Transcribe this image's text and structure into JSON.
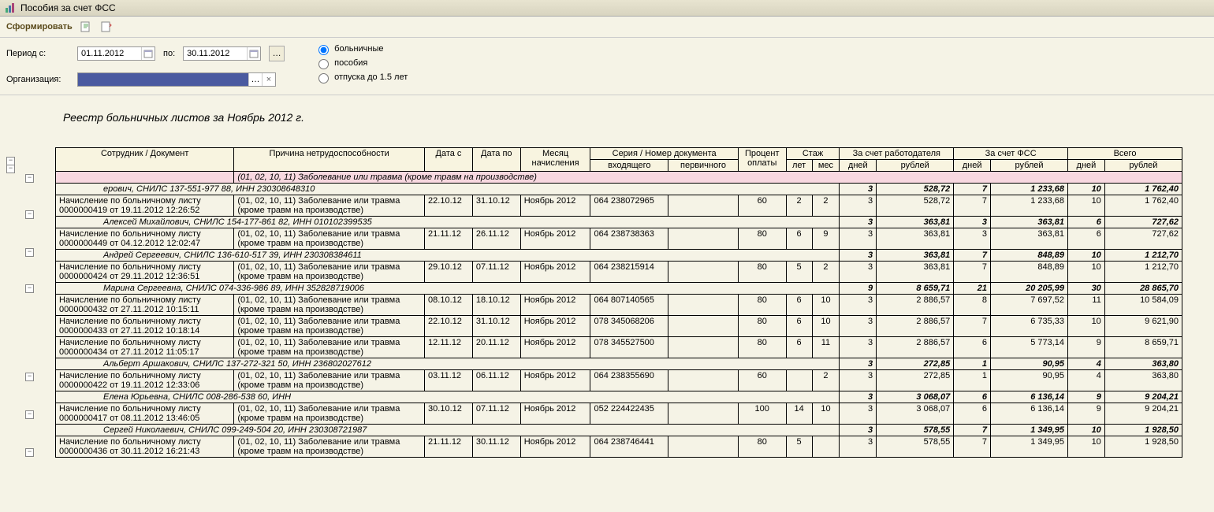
{
  "window_title": "Пособия за счет ФСС",
  "toolbar": {
    "form_label": "Сформировать"
  },
  "params": {
    "period_label": "Период с:",
    "period_to_label": "по:",
    "date_from": "01.11.2012",
    "date_to": "30.11.2012",
    "org_label": "Организация:",
    "radio_sick": "больничные",
    "radio_benefits": "пособия",
    "radio_leave": "отпуска до 1.5 лет"
  },
  "report_title": "Реестр больничных листов за Ноябрь 2012 г.",
  "headers": {
    "employee_doc": "Сотрудник / Документ",
    "reason": "Причина нетрудоспособности",
    "date_from": "Дата с",
    "date_to": "Дата по",
    "month": "Месяц начисления",
    "series_number": "Серия / Номер  документа",
    "series_in": "входящего",
    "series_primary": "первичного",
    "percent": "Процент оплаты",
    "stazh": "Стаж",
    "stazh_years": "лет",
    "stazh_months": "мес",
    "employer": "За счет работодателя",
    "fss": "За счет ФСС",
    "total": "Всего",
    "days": "дней",
    "rub": "рублей"
  },
  "pink_reason": "(01, 02, 10, 11) Заболевание или травма (кроме травм на производстве)",
  "groups": [
    {
      "header_text": "ерович, СНИЛС 137-551-977 88, ИНН 230308648310",
      "emp_days": "3",
      "emp_rub": "528,72",
      "fss_days": "7",
      "fss_rub": "1 233,68",
      "tot_days": "10",
      "tot_rub": "1 762,40",
      "rows": [
        {
          "doc": "Начисление по больничному листу 0000000419 от 19.11.2012 12:26:52",
          "reason": "(01, 02, 10, 11) Заболевание или травма (кроме травм на производстве)",
          "d1": "22.10.12",
          "d2": "31.10.12",
          "month": "Ноябрь 2012",
          "ser_in": "064 238072965",
          "ser_pr": "",
          "pct": "60",
          "yrs": "2",
          "mon": "2",
          "ed": "3",
          "er": "528,72",
          "fd": "7",
          "fr": "1 233,68",
          "td": "10",
          "tr": "1 762,40"
        }
      ]
    },
    {
      "header_text": "Алексей Михайлович, СНИЛС 154-177-861 82, ИНН 010102399535",
      "emp_days": "3",
      "emp_rub": "363,81",
      "fss_days": "3",
      "fss_rub": "363,81",
      "tot_days": "6",
      "tot_rub": "727,62",
      "rows": [
        {
          "doc": "Начисление по больничному листу 0000000449 от 04.12.2012 12:02:47",
          "reason": "(01, 02, 10, 11) Заболевание или травма (кроме травм на производстве)",
          "d1": "21.11.12",
          "d2": "26.11.12",
          "month": "Ноябрь 2012",
          "ser_in": "064 238738363",
          "ser_pr": "",
          "pct": "80",
          "yrs": "6",
          "mon": "9",
          "ed": "3",
          "er": "363,81",
          "fd": "3",
          "fr": "363,81",
          "td": "6",
          "tr": "727,62"
        }
      ]
    },
    {
      "header_text": "Андрей Сергеевич, СНИЛС 136-610-517 39, ИНН 230308384611",
      "emp_days": "3",
      "emp_rub": "363,81",
      "fss_days": "7",
      "fss_rub": "848,89",
      "tot_days": "10",
      "tot_rub": "1 212,70",
      "rows": [
        {
          "doc": "Начисление по больничному листу 0000000424 от 29.11.2012 12:36:51",
          "reason": "(01, 02, 10, 11) Заболевание или травма (кроме травм на производстве)",
          "d1": "29.10.12",
          "d2": "07.11.12",
          "month": "Ноябрь 2012",
          "ser_in": "064 238215914",
          "ser_pr": "",
          "pct": "80",
          "yrs": "5",
          "mon": "2",
          "ed": "3",
          "er": "363,81",
          "fd": "7",
          "fr": "848,89",
          "td": "10",
          "tr": "1 212,70"
        }
      ]
    },
    {
      "header_text": "Марина Сергеевна, СНИЛС 074-336-986 89, ИНН 352828719006",
      "emp_days": "9",
      "emp_rub": "8 659,71",
      "fss_days": "21",
      "fss_rub": "20 205,99",
      "tot_days": "30",
      "tot_rub": "28 865,70",
      "rows": [
        {
          "doc": "Начисление по больничному листу 0000000432 от 27.11.2012 10:15:11",
          "reason": "(01, 02, 10, 11) Заболевание или травма (кроме травм на производстве)",
          "d1": "08.10.12",
          "d2": "18.10.12",
          "month": "Ноябрь 2012",
          "ser_in": "064 807140565",
          "ser_pr": "",
          "pct": "80",
          "yrs": "6",
          "mon": "10",
          "ed": "3",
          "er": "2 886,57",
          "fd": "8",
          "fr": "7 697,52",
          "td": "11",
          "tr": "10 584,09"
        },
        {
          "doc": "Начисление по больничному листу 0000000433 от 27.11.2012 10:18:14",
          "reason": "(01, 02, 10, 11) Заболевание или травма (кроме травм на производстве)",
          "d1": "22.10.12",
          "d2": "31.10.12",
          "month": "Ноябрь 2012",
          "ser_in": "078 345068206",
          "ser_pr": "",
          "pct": "80",
          "yrs": "6",
          "mon": "10",
          "ed": "3",
          "er": "2 886,57",
          "fd": "7",
          "fr": "6 735,33",
          "td": "10",
          "tr": "9 621,90"
        },
        {
          "doc": "Начисление по больничному листу 0000000434 от 27.11.2012 11:05:17",
          "reason": "(01, 02, 10, 11) Заболевание или травма (кроме травм на производстве)",
          "d1": "12.11.12",
          "d2": "20.11.12",
          "month": "Ноябрь 2012",
          "ser_in": "078 345527500",
          "ser_pr": "",
          "pct": "80",
          "yrs": "6",
          "mon": "11",
          "ed": "3",
          "er": "2 886,57",
          "fd": "6",
          "fr": "5 773,14",
          "td": "9",
          "tr": "8 659,71"
        }
      ]
    },
    {
      "header_text": "Альберт Аршакович, СНИЛС 137-272-321 50, ИНН 236802027612",
      "emp_days": "3",
      "emp_rub": "272,85",
      "fss_days": "1",
      "fss_rub": "90,95",
      "tot_days": "4",
      "tot_rub": "363,80",
      "rows": [
        {
          "doc": "Начисление по больничному листу 0000000422 от 19.11.2012 12:33:06",
          "reason": "(01, 02, 10, 11) Заболевание или травма (кроме травм на производстве)",
          "d1": "03.11.12",
          "d2": "06.11.12",
          "month": "Ноябрь 2012",
          "ser_in": "064 238355690",
          "ser_pr": "",
          "pct": "60",
          "yrs": "",
          "mon": "2",
          "ed": "3",
          "er": "272,85",
          "fd": "1",
          "fr": "90,95",
          "td": "4",
          "tr": "363,80"
        }
      ]
    },
    {
      "header_text": "Елена Юрьевна, СНИЛС 008-286-538 60, ИНН",
      "emp_days": "3",
      "emp_rub": "3 068,07",
      "fss_days": "6",
      "fss_rub": "6 136,14",
      "tot_days": "9",
      "tot_rub": "9 204,21",
      "rows": [
        {
          "doc": "Начисление по больничному листу 0000000417 от 08.11.2012 13:46:05",
          "reason": "(01, 02, 10, 11) Заболевание или травма (кроме травм на производстве)",
          "d1": "30.10.12",
          "d2": "07.11.12",
          "month": "Ноябрь 2012",
          "ser_in": "052 224422435",
          "ser_pr": "",
          "pct": "100",
          "yrs": "14",
          "mon": "10",
          "ed": "3",
          "er": "3 068,07",
          "fd": "6",
          "fr": "6 136,14",
          "td": "9",
          "tr": "9 204,21"
        }
      ]
    },
    {
      "header_text": "Сергей Николаевич, СНИЛС 099-249-504 20, ИНН 230308721987",
      "emp_days": "3",
      "emp_rub": "578,55",
      "fss_days": "7",
      "fss_rub": "1 349,95",
      "tot_days": "10",
      "tot_rub": "1 928,50",
      "rows": [
        {
          "doc": "Начисление по больничному листу 0000000436 от 30.11.2012 16:21:43",
          "reason": "(01, 02, 10, 11) Заболевание или травма (кроме травм на производстве)",
          "d1": "21.11.12",
          "d2": "30.11.12",
          "month": "Ноябрь 2012",
          "ser_in": "064 238746441",
          "ser_pr": "",
          "pct": "80",
          "yrs": "5",
          "mon": "",
          "ed": "3",
          "er": "578,55",
          "fd": "7",
          "fr": "1 349,95",
          "td": "10",
          "tr": "1 928,50"
        }
      ]
    }
  ]
}
